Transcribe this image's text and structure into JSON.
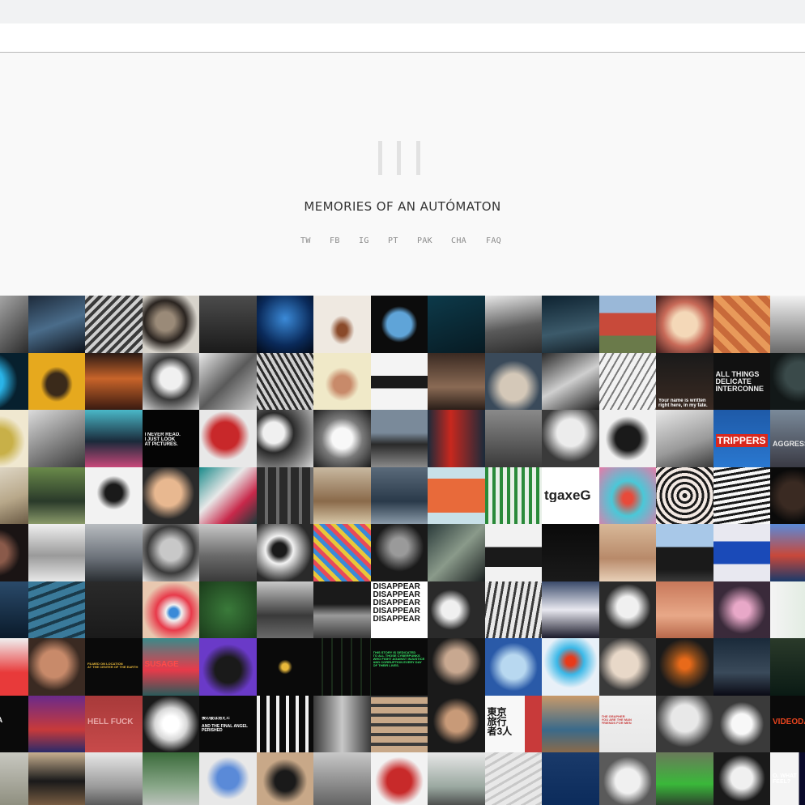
{
  "site": {
    "title": "MEMORIES OF AN AUTÓMATON"
  },
  "nav": {
    "items": [
      "TW",
      "FB",
      "IG",
      "PT",
      "PAK",
      "CHA",
      "FAQ"
    ]
  },
  "colors": {
    "top_strip": "#f1f2f3",
    "header_bg": "#f9f9f9",
    "logo": "#e2e2e2",
    "nav_text": "#8a8a8a",
    "title_text": "#333333"
  },
  "grid": {
    "columns": 15,
    "rows": 9,
    "tiles": [
      {
        "bg": "linear-gradient(135deg,#cfcfcf,#2a2a2a)"
      },
      {
        "bg": "linear-gradient(160deg,#1d2a3a,#4a6c8a,#0c1018)"
      },
      {
        "bg": "repeating-linear-gradient(135deg,#cfcfcf 0 4px,#3a3a3a 4px 8px)"
      },
      {
        "bg": "radial-gradient(circle at 40% 45%,#9a8a78 0 20%,#2a2420 45%,#d8d4cc 70%)"
      },
      {
        "bg": "linear-gradient(180deg,#4c4c4c,#1a1a1a)"
      },
      {
        "bg": "radial-gradient(circle at 50% 40%,#3b8ad8,#0a2a5a 60%,#020814)"
      },
      {
        "bg": "radial-gradient(ellipse at 50% 60%,#8a4a2a 0 12%,#efe9e1 30%)"
      },
      {
        "bg": "radial-gradient(circle at 50% 50%,#5fa4d8 0 30%,#0c0c0c 45%)"
      },
      {
        "bg": "linear-gradient(160deg,#0d3a4a,#071a22)"
      },
      {
        "bg": "linear-gradient(170deg,#e8e8e8,#5a5a5a 55%,#2c2c2c)"
      },
      {
        "bg": "linear-gradient(170deg,#0d2230,#3c5a6a 60%,#142028)"
      },
      {
        "bg": "linear-gradient(180deg,#9ab8d8 0 30%,#c84a3a 30% 70%,#6a7a4a 70%)"
      },
      {
        "bg": "radial-gradient(circle at 50% 50%,#f4d8b8 0 30%,#c86a58 55%,#3a1a1a)"
      },
      {
        "bg": "repeating-linear-gradient(45deg,#e89a5a 0 8px,#c86a3a 8px 16px)"
      },
      {
        "bg": "linear-gradient(180deg,#f2f2f2,#6a6a6a)"
      },
      {
        "bg": "radial-gradient(circle at 30% 50%,#2ab4e8 0 30%,#07202e 60%)"
      },
      {
        "bg": "radial-gradient(ellipse at 50% 55%,#3a2a1a 0 25%,#e6a91e 40%)"
      },
      {
        "bg": "linear-gradient(180deg,#2a1a14,#c8642a 45%,#3a1a10)"
      },
      {
        "bg": "radial-gradient(circle at 50% 45%,#f0f0f0 0 25%,#3a3a3a 50%,#dcdcdc)"
      },
      {
        "bg": "linear-gradient(135deg,#e8e8e8,#5a5a5a 50%,#cfcfcf)"
      },
      {
        "bg": "repeating-linear-gradient(60deg,#2a2a2a 0 3px,#cfcfcf 3px 7px)"
      },
      {
        "bg": "radial-gradient(circle at 50% 55%,#c88a6a 0 20%,#f0e9c8 40%)"
      },
      {
        "bg": "linear-gradient(180deg,#f4f4f4 0 40%,#1a1a1a 40% 62%,#f4f4f4 62%)"
      },
      {
        "bg": "linear-gradient(180deg,#3a2a22,#8a6a54 60%,#2a1e18)"
      },
      {
        "bg": "radial-gradient(circle at 50% 60%,#d4c8b8 0 30%,#3a4a5a 60%)"
      },
      {
        "bg": "linear-gradient(150deg,#2a2a2a,#cfcfcf 50%,#1a1a1a)"
      },
      {
        "bg": "repeating-linear-gradient(120deg,#f2f2f2 0 6px,#7a7a7a 6px 8px)"
      },
      {
        "bg": "linear-gradient(180deg,#1a1a1a,#3a2a22)",
        "cap": "Your name is written\nright here, in my fate.",
        "cc": "#ffffff",
        "cs": "6px",
        "ct": "56px"
      },
      {
        "bg": "linear-gradient(180deg,#111,#111)",
        "cap": "ALL THINGS\nDELICATE\nINTERCONNE",
        "cc": "#f0f0f0",
        "cs": "9px",
        "ct": "22px"
      },
      {
        "bg": "radial-gradient(circle at 50% 40%,#3a4a4a 0 30%,#121818 60%)"
      },
      {
        "bg": "radial-gradient(circle at 50% 55%,#c8b048 0 30%,#f0e8d0 60%)"
      },
      {
        "bg": "linear-gradient(150deg,#dcdcdc,#7a7a7a 60%,#3a3a3a)"
      },
      {
        "bg": "linear-gradient(180deg,#4ab8c8,#1a2a3a 55%,#c8487a)"
      },
      {
        "bg": "linear-gradient(180deg,#050505,#050505)",
        "cap": "I NEVER READ.\nI JUST LOOK\nAT PICTURES.",
        "cc": "#ffffff",
        "cs": "6px",
        "ct": "28px"
      },
      {
        "bg": "radial-gradient(circle at 45% 45%,#c8282a 0 30%,#e8e8e8 55%)"
      },
      {
        "bg": "radial-gradient(circle at 30% 40%,#f0f0f0 0 20%,#2a2a2a 38%,#d8d8d8)"
      },
      {
        "bg": "radial-gradient(circle at 50% 50%,#f8f8f8 0 25%,#7a7a7a 50%,#1a1a1a)"
      },
      {
        "bg": "linear-gradient(180deg,#7a8a9a 0 40%,#2a2a2a 60%,#8a8a8a)"
      },
      {
        "bg": "linear-gradient(90deg,#1a2a3a,#c8281e 40%,#1a2a3a)"
      },
      {
        "bg": "linear-gradient(180deg,#8a8a8a,#3a3a3a)"
      },
      {
        "bg": "radial-gradient(circle at 50% 40%,#ececec 0 30%,#3a3a3a 65%)"
      },
      {
        "bg": "radial-gradient(circle at 50% 50%,#1a1a1a 0 30%,#f0f0f0 55%)"
      },
      {
        "bg": "linear-gradient(160deg,#e8e8e8,#9a9a9a 60%,#3a3a3a)"
      },
      {
        "bg": "linear-gradient(180deg,#1e5aa8,#2a78d0)",
        "cap": "TRIPPERS",
        "cc": "#ffffff",
        "cs": "12px",
        "ct": "30px",
        "cbg": "#d8281e"
      },
      {
        "bg": "linear-gradient(180deg,#7a8a9a,#3a3a44)",
        "cap": "AGGRESSIVE",
        "cc": "#e8e8e8",
        "cs": "9px",
        "ct": "38px"
      },
      {
        "bg": "linear-gradient(160deg,#e8e2d4,#b8a88a 60%,#6a5a44)"
      },
      {
        "bg": "linear-gradient(180deg,#6a8a4a,#2a3a2a 60%,#8a9a6a)"
      },
      {
        "bg": "radial-gradient(circle at 50% 45%,#1a1a1a 0 20%,#f2f2f2 40%)"
      },
      {
        "bg": "radial-gradient(circle at 45% 45%,#e8b890 0 30%,#2a2a2a 60%)"
      },
      {
        "bg": "linear-gradient(135deg,#1a8a8a,#e8e8e8 40%,#c8284a 70%,#1a3a3a)"
      },
      {
        "bg": "repeating-linear-gradient(90deg,#2a2a2a 0 10px,#6a6a6a 10px 14px)"
      },
      {
        "bg": "linear-gradient(180deg,#c8b8a0,#8a6a4a 60%,#d8c8a8)"
      },
      {
        "bg": "linear-gradient(180deg,#5a6a7a,#2a3a4a 60%,#8a9aa8)"
      },
      {
        "bg": "linear-gradient(180deg,#c8e0e8 0 20%,#e86a3a 20% 80%,#c8e0e8 80%)"
      },
      {
        "bg": "repeating-linear-gradient(90deg,#2a8a3a 0 4px,#e8f0e8 4px 9px)"
      },
      {
        "bg": "linear-gradient(180deg,#ffffff,#ffffff)",
        "cap": "tgaxeG",
        "cc": "#222222",
        "cs": "17px",
        "ct": "26px"
      },
      {
        "bg": "radial-gradient(ellipse at 50% 55%,#e84a3a 0 12%,#4ac8d8 40%,#e87aa8)"
      },
      {
        "bg": "repeating-radial-gradient(circle at 50% 50%,#1a1a1a 0 3px,#f2e8e2 3px 7px)"
      },
      {
        "bg": "repeating-linear-gradient(170deg,#f8f8f8 0 4px,#1a1a1a 4px 7px)"
      },
      {
        "bg": "radial-gradient(circle at 40% 50%,#3a2a22 0 30%,#0a0a0a 60%)"
      },
      {
        "bg": "radial-gradient(circle at 45% 50%,#8a5a4a 0 25%,#1a1414 55%)"
      },
      {
        "bg": "linear-gradient(180deg,#f0f0f0,#9a9a9a 55%,#e8e8e8)"
      },
      {
        "bg": "linear-gradient(180deg,#b8bcc0,#6a7078 60%,#2a2e32)"
      },
      {
        "bg": "radial-gradient(circle at 50% 45%,#c8c8c8 0 25%,#3a3a3a 55%,#f0f0f0)"
      },
      {
        "bg": "linear-gradient(180deg,#c8c8c8,#6a6a6a 55%,#3a3a3a)"
      },
      {
        "bg": "radial-gradient(circle at 40% 45%,#1a1a1a 0 15%,#f2f2f2 30%,#2a2a2a 70%)"
      },
      {
        "bg": "repeating-linear-gradient(45deg,#e84a5a 0 5px,#e8c83a 5px 10px,#3a8ad8 10px 15px)"
      },
      {
        "bg": "radial-gradient(circle at 50% 40%,#9a9a9a 0 20%,#1a1a1a 55%)"
      },
      {
        "bg": "linear-gradient(135deg,#2a3a3a,#8a9a8a 50%,#1a2020)"
      },
      {
        "bg": "linear-gradient(180deg,#f2f2f2 0 40%,#1a1a1a 40% 75%,#f2f2f2 75%)"
      },
      {
        "bg": "linear-gradient(180deg,#0a0a0a,#1a1a1a)"
      },
      {
        "bg": "linear-gradient(180deg,#d8b898,#b88a6a 60%,#e8d0b8)"
      },
      {
        "bg": "linear-gradient(180deg,#a8c8e8 0 40%,#1a1a1a 40% 80%,#3a3a3a)"
      },
      {
        "bg": "linear-gradient(180deg,#e8e8f0 0 30%,#1a4ab8 30% 70%,#e8e8f0 70%)"
      },
      {
        "bg": "linear-gradient(180deg,#5a8ad8,#c8483a 55%,#1a3a6a)"
      },
      {
        "bg": "linear-gradient(180deg,#2a4a6a,#0a1a2a)"
      },
      {
        "bg": "repeating-linear-gradient(160deg,#3a7a9a 0 8px,#1a3a4a 8px 12px)"
      },
      {
        "bg": "linear-gradient(180deg,#2a2a2a,#1a1a1a)"
      },
      {
        "bg": "radial-gradient(ellipse at 55% 55%,#3a8ad8 0 10%,#f0f0f0 18%,#e83a4a 40%,#e8c8b0 70%)"
      },
      {
        "bg": "radial-gradient(circle at 50% 50%,#3a7a3a,#1a3a1a)"
      },
      {
        "bg": "linear-gradient(180deg,#c8c8c8,#3a3a3a 60%,#6a6a6a)"
      },
      {
        "bg": "linear-gradient(180deg,#1a1a1a 0 40%,#9a9a9a 60%,#3a3a3a)"
      },
      {
        "bg": "linear-gradient(180deg,#ffffff,#ffffff)",
        "cap": "DISAPPEAR\nDISAPPEAR\nDISAPPEAR\nDISAPPEAR\nDISAPPEAR",
        "cc": "#111111",
        "cs": "10px",
        "ct": "2px"
      },
      {
        "bg": "radial-gradient(circle at 40% 50%,#f0f0f0 0 20%,#2a2a2a 45%)"
      },
      {
        "bg": "repeating-linear-gradient(100deg,#e8e8e8 0 5px,#3a3a3a 5px 8px)"
      },
      {
        "bg": "linear-gradient(180deg,#3a4a6a,#e8e8f0 50%,#1a1a2a)"
      },
      {
        "bg": "radial-gradient(circle at 50% 45%,#f0f0f0 0 25%,#2a2a2a 55%)"
      },
      {
        "bg": "linear-gradient(180deg,#c8785a,#e8a888 60%,#b8684a)"
      },
      {
        "bg": "radial-gradient(ellipse at 50% 50%,#e8a8c8 0 20%,#3a2a3a 60%)"
      },
      {
        "bg": "linear-gradient(90deg,#f4f4f4,#d8e8d8)"
      },
      {
        "bg": "linear-gradient(180deg,#f0f0f0,#e83a3a 60%)",
        "cap": "LOVE",
        "cc": "#c81a1a",
        "cs": "11px",
        "ct": "34px"
      },
      {
        "bg": "radial-gradient(circle at 45% 45%,#c88a6a 0 30%,#3a2a22 60%)"
      },
      {
        "bg": "linear-gradient(180deg,#0a0a0a,#0a0a0a)",
        "cap": "FILMED ON LOCATION\nAT THE CENTER OF THE EARTH",
        "cc": "#e8b83a",
        "cs": "4px",
        "ct": "30px"
      },
      {
        "bg": "linear-gradient(180deg,#3a8a8a,#e83a4a 55%,#2a5a5a)",
        "cap": "SUSAGE",
        "cc": "#ff4a4a",
        "cs": "10px",
        "ct": "28px"
      },
      {
        "bg": "radial-gradient(circle at 50% 55%,#1a1a1a 0 30%,#6a3ac8 60%)"
      },
      {
        "bg": "radial-gradient(circle at 50% 50%,#e8b83a 0 8%,#0a0a0a 18%)"
      },
      {
        "bg": "repeating-linear-gradient(90deg,#0a0a0a 0 10px,#1a2a1a 10px 12px)"
      },
      {
        "bg": "linear-gradient(180deg,#0a0a0a,#0a0a0a)",
        "cap": "THIS STORY IS DEDICATED\nTO ALL THOSE CYBERPUNKS\nWHO FIGHT AGAINST INJUSTICE\nAND CORRUPTION EVERY DAY\nOF THEIR LIVES.",
        "cc": "#3ae86a",
        "cs": "4px",
        "ct": "16px"
      },
      {
        "bg": "radial-gradient(circle at 50% 40%,#c8a890 0 25%,#1a1a1a 55%)"
      },
      {
        "bg": "radial-gradient(circle at 50% 50%,#b8d8f0 0 30%,#2a5aa8 60%)"
      },
      {
        "bg": "radial-gradient(circle at 50% 40%,#e83a1a 0 10%,#3ab8e8 30%,#e8f0f8 60%)"
      },
      {
        "bg": "radial-gradient(circle at 45% 45%,#e8d8c8 0 30%,#3a3a3a 60%)"
      },
      {
        "bg": "radial-gradient(circle at 50% 45%,#e86a1a 0 12%,#8a4a1a 30%,#1a1a1a 60%)"
      },
      {
        "bg": "linear-gradient(180deg,#1a2a3a,#3a4a5a 60%,#0a0a14)"
      },
      {
        "bg": "linear-gradient(180deg,#2a3a2a,#0a1a14)"
      },
      {
        "bg": "linear-gradient(180deg,#0a0a0a,#0a0a0a)",
        "cap": "S NOT A\nTOM",
        "cc": "#ffffff",
        "cs": "9px",
        "ct": "26px"
      },
      {
        "bg": "linear-gradient(180deg,#6a2a8a,#c83a3a 60%,#2a2a6a)"
      },
      {
        "bg": "linear-gradient(180deg,#a83a3a,#c84a4a)",
        "cap": "HELL FUCK",
        "cc": "#e8a8a8",
        "cs": "10px",
        "ct": "28px"
      },
      {
        "bg": "radial-gradient(circle at 50% 50%,#ffffff 0 20%,#d8d8d8 40%,#1a1a1a 70%)"
      },
      {
        "bg": "linear-gradient(180deg,#0a0a0a,#0a0a0a)",
        "cap": "後の彼は消えた\n\nAND THE FINAL ANGEL PERISHED",
        "cc": "#ffffff",
        "cs": "5px",
        "ct": "26px"
      },
      {
        "bg": "repeating-linear-gradient(90deg,#f0f0f0 0 4px,#0a0a0a 4px 12px)"
      },
      {
        "bg": "linear-gradient(90deg,#3a3a3a,#c8c8c8 50%,#3a3a3a)"
      },
      {
        "bg": "repeating-linear-gradient(0deg,#c8a888 0 8px,#3a3a3a 8px 12px)"
      },
      {
        "bg": "radial-gradient(circle at 50% 45%,#c89a78 0 25%,#1a1a1a 55%)"
      },
      {
        "bg": "linear-gradient(90deg,#f8f8f8 0 70%,#c83a3a 70%)",
        "cap": "東京\n旅行\n者3人",
        "cc": "#111111",
        "cs": "12px",
        "ct": "14px"
      },
      {
        "bg": "linear-gradient(180deg,#c89a6a,#3a6a8a 60%,#8a6a4a)"
      },
      {
        "bg": "linear-gradient(180deg,#f0f0f0,#e8e8e8)",
        "cap": "THE GRAPHER\nYOU ARE THE MAN\nFRIENDS FOR MEN",
        "cc": "#c83a3a",
        "cs": "4px",
        "ct": "24px"
      },
      {
        "bg": "radial-gradient(circle at 50% 40%,#e8e8e8 0 30%,#3a3a3a 65%)"
      },
      {
        "bg": "radial-gradient(circle at 50% 50%,#f8f8f8 0 25%,#3a3a3a 55%)"
      },
      {
        "bg": "linear-gradient(180deg,#0a0a0a,#0a0a0a)",
        "cap": "VIDEODA",
        "cc": "#e8441e",
        "cs": "10px",
        "ct": "28px"
      },
      {
        "bg": "linear-gradient(180deg,#c8c8c0,#8a8a7a)"
      },
      {
        "bg": "linear-gradient(180deg,#c8b090,#1a1a1a 50%,#8a6a4a)"
      },
      {
        "bg": "linear-gradient(180deg,#e8e8e8,#9a9a9a 60%,#4a4a4a)"
      },
      {
        "bg": "linear-gradient(180deg,#3a6a3a,#8aa88a 60%,#c8c8c8)"
      },
      {
        "bg": "radial-gradient(circle at 50% 45%,#5a8ad8 0 25%,#e8e8e8 50%)"
      },
      {
        "bg": "radial-gradient(circle at 50% 50%,#1a1a1a 0 25%,#c8a888 55%)"
      },
      {
        "bg": "linear-gradient(180deg,#c8c8c8,#5a5a5a)"
      },
      {
        "bg": "radial-gradient(circle at 50% 50%,#c82a2a 0 30%,#f2f2f2 60%)"
      },
      {
        "bg": "linear-gradient(180deg,#e8e8e8,#9aa8a0 60%,#3a3a3a)"
      },
      {
        "bg": "repeating-linear-gradient(150deg,#e8e8e8 0 6px,#c8c8c8 6px 9px)"
      },
      {
        "bg": "linear-gradient(180deg,#1a3a6a,#0a2a5a)"
      },
      {
        "bg": "radial-gradient(circle at 50% 50%,#f0f0f0 0 30%,#5a5a5a 60%)"
      },
      {
        "bg": "linear-gradient(180deg,#6a7a5a,#3ab83a 55%,#2a2a2a)"
      },
      {
        "bg": "radial-gradient(circle at 50% 45%,#f0f0f0 0 25%,#1a1a1a 55%)"
      },
      {
        "bg": "linear-gradient(90deg,#f4f4f4 0 50%,#0a0a2a 50%)",
        "cap": "O. WHAT\nFEEL?",
        "cc": "#ffffff",
        "cs": "7px",
        "ct": "26px"
      }
    ]
  }
}
